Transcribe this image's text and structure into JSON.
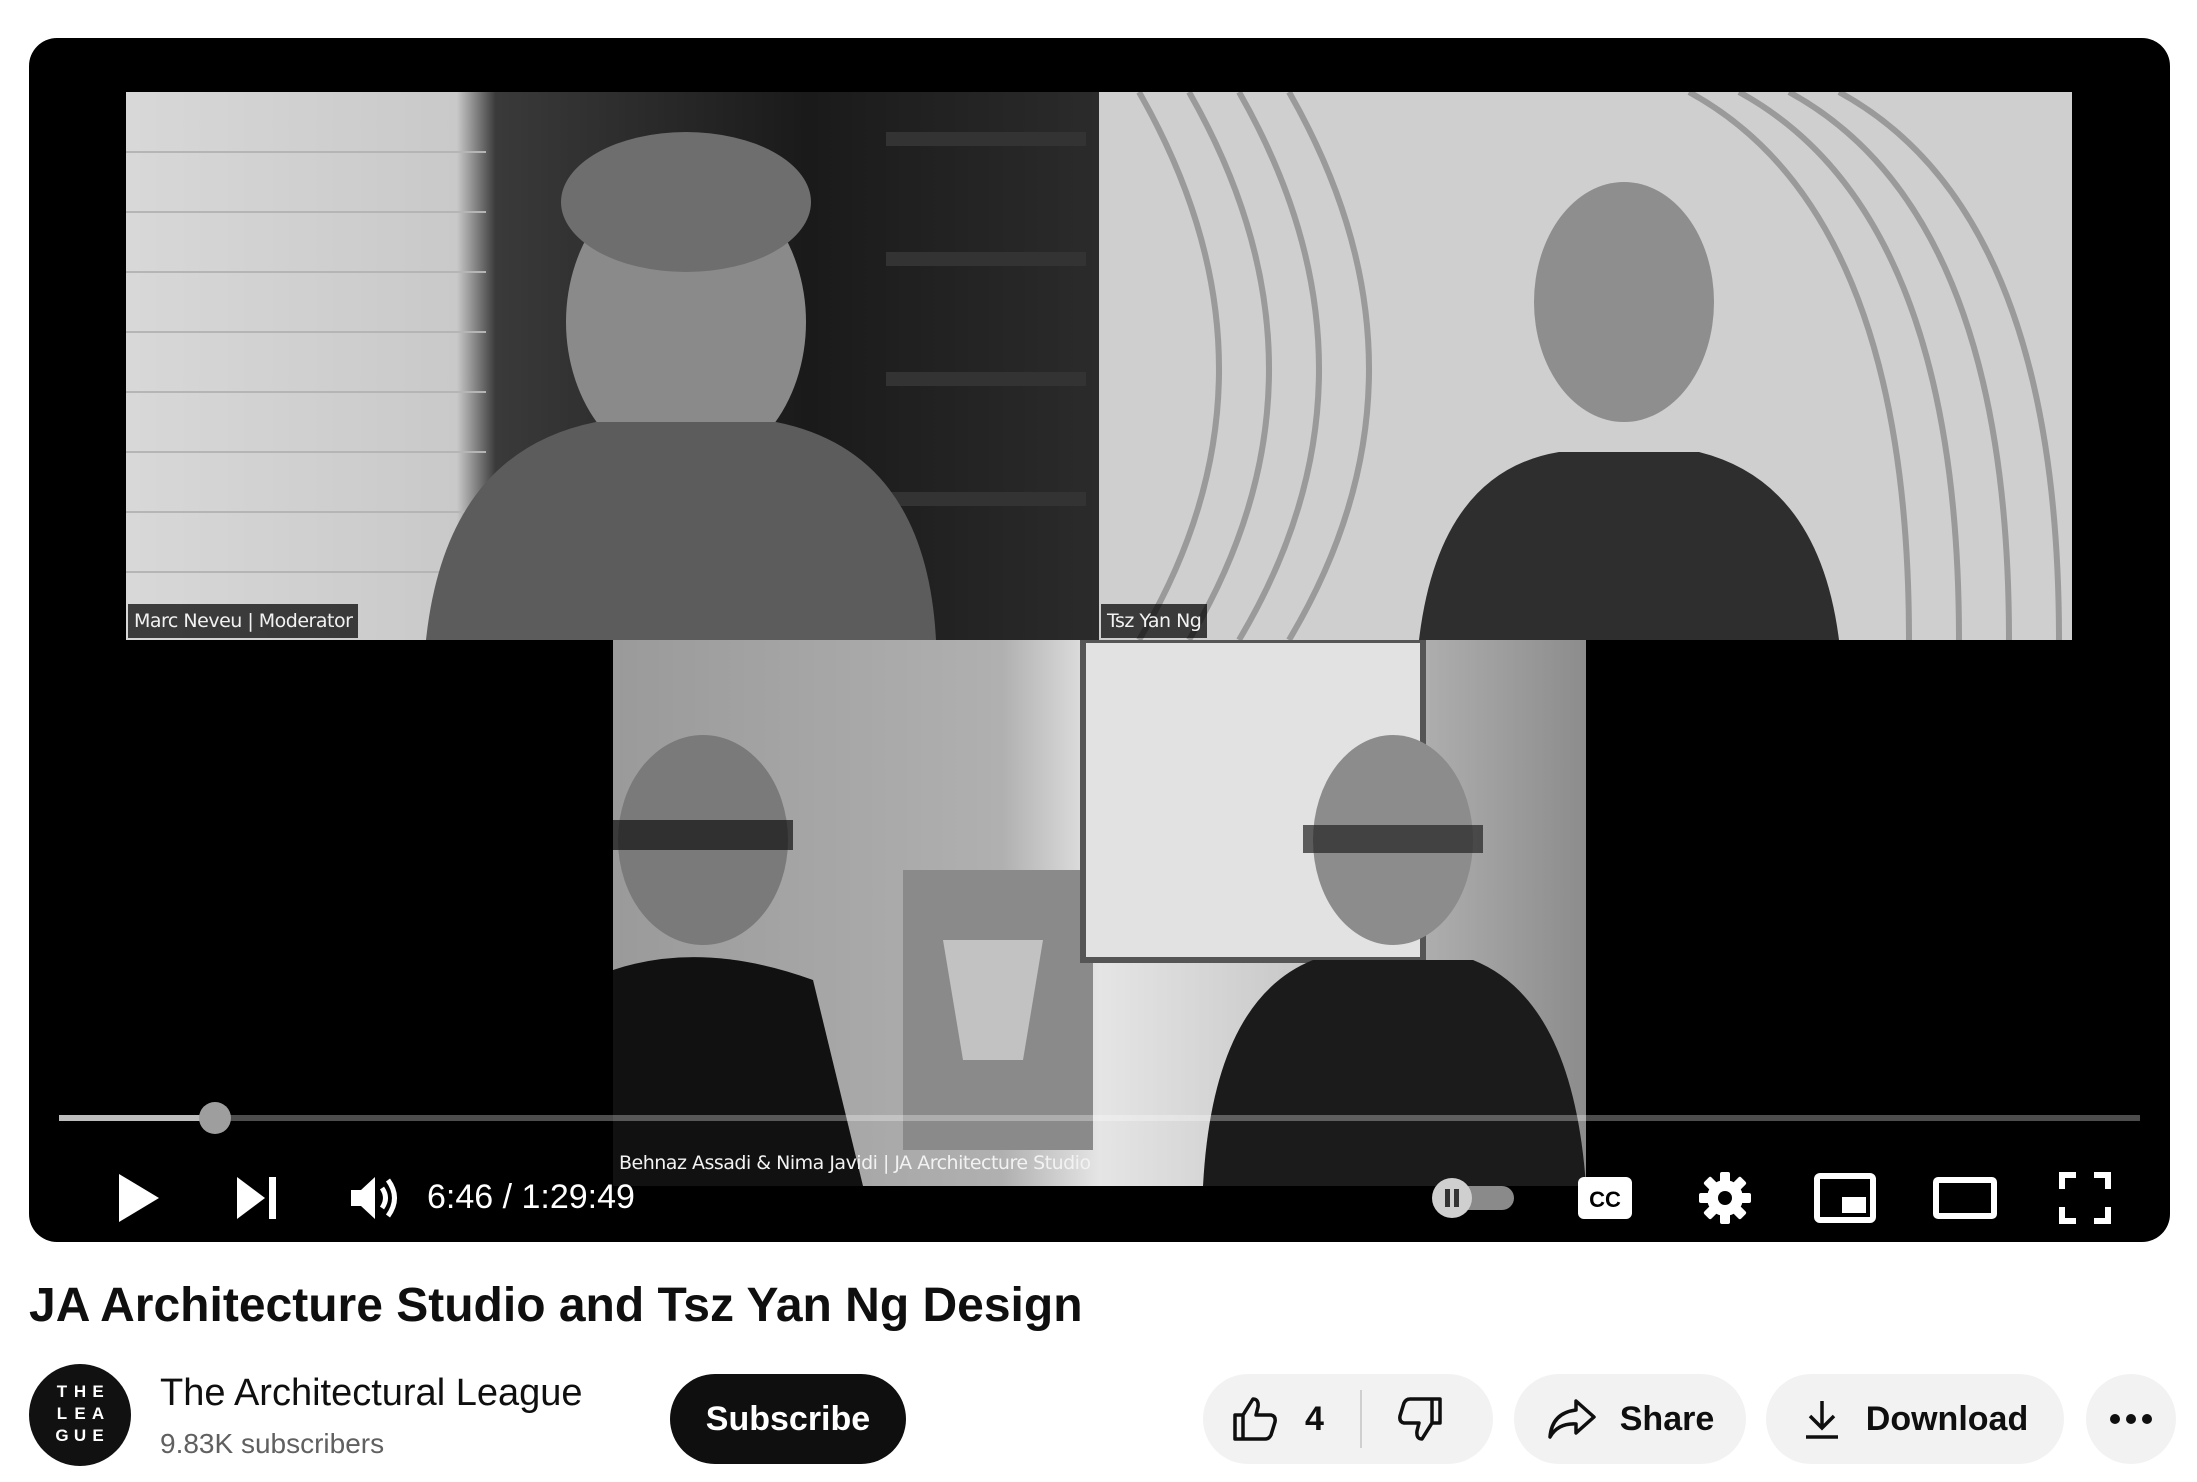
{
  "video": {
    "participants": [
      {
        "label": "Marc Neveu | Moderator"
      },
      {
        "label": "Tsz Yan Ng"
      },
      {
        "label": "Behnaz Assadi & Nima Javidi | JA Architecture Studio"
      }
    ],
    "progress_fraction": 0.075,
    "time_display": "6:46 / 1:29:49",
    "controls": {
      "play": "play-icon",
      "next": "skip-next-icon",
      "volume": "volume-icon",
      "autoplay": "autoplay-toggle-icon",
      "captions": "cc-icon",
      "settings": "gear-icon",
      "miniplayer": "miniplayer-icon",
      "theater": "theater-mode-icon",
      "fullscreen": "fullscreen-icon"
    }
  },
  "title": "JA Architecture Studio and Tsz Yan Ng Design",
  "channel": {
    "logo_letters": [
      "T",
      "H",
      "E",
      "L",
      "E",
      "A",
      "G",
      "U",
      "E"
    ],
    "name": "The Architectural League",
    "subscribers": "9.83K subscribers",
    "subscribe_label": "Subscribe"
  },
  "actions": {
    "like_count": "4",
    "share_label": "Share",
    "download_label": "Download"
  },
  "colors": {
    "player_bg": "#000000",
    "pill_bg": "#f2f2f2",
    "subscribe_bg": "#0f0f0f",
    "secondary_text": "#606060"
  }
}
